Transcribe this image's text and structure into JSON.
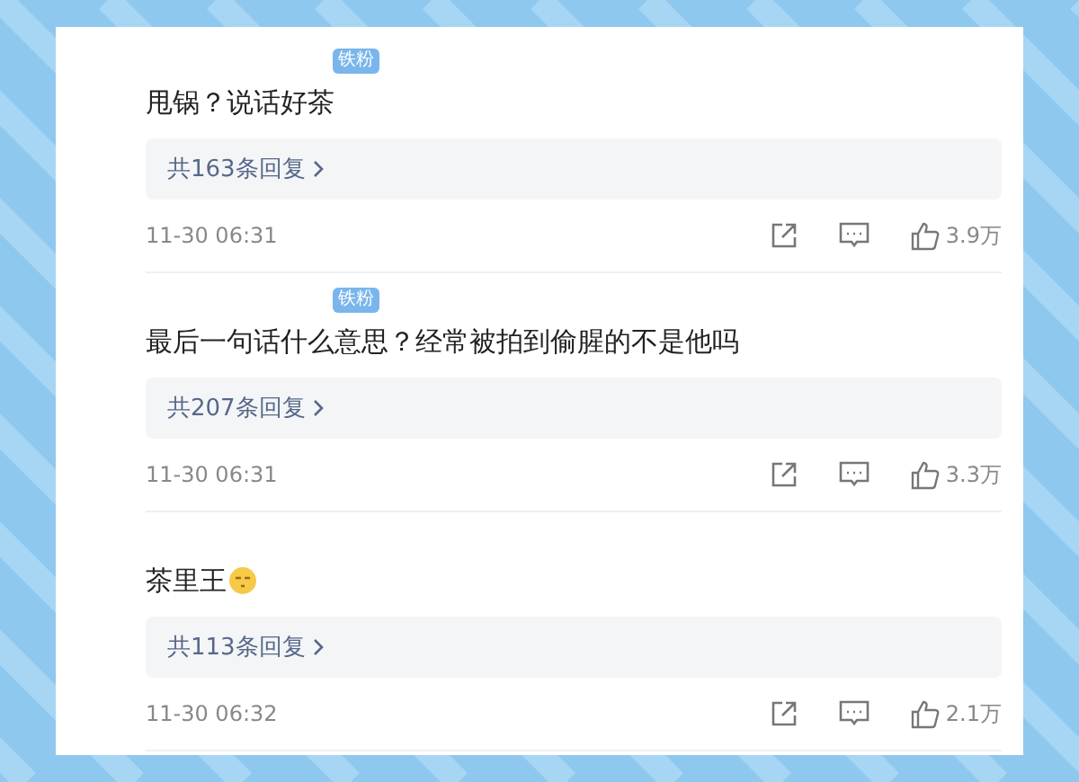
{
  "comments": [
    {
      "badge": "铁粉",
      "text": "甩锅？说话好茶",
      "replies": "共163条回复",
      "time": "11-30 06:31",
      "likes": "3.9万"
    },
    {
      "badge": "铁粉",
      "text": "最后一句话什么意思？经常被拍到偷腥的不是他吗",
      "replies": "共207条回复",
      "time": "11-30 06:31",
      "likes": "3.3万"
    },
    {
      "text": "茶里王",
      "emoji": true,
      "replies": "共113条回复",
      "time": "11-30 06:32",
      "likes": "2.1万"
    }
  ]
}
